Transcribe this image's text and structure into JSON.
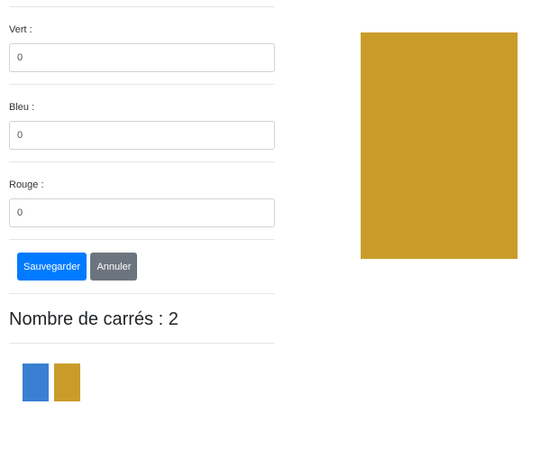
{
  "form": {
    "fields": [
      {
        "label": "Vert :",
        "value": "0"
      },
      {
        "label": "Bleu :",
        "value": "0"
      },
      {
        "label": "Rouge :",
        "value": "0"
      }
    ],
    "save_label": "Sauvegarder",
    "cancel_label": "Annuler"
  },
  "squares": {
    "count_title": "Nombre de carrés : 2",
    "items": [
      {
        "color": "#3a7fd1"
      },
      {
        "color": "#c99c2a"
      }
    ]
  },
  "preview": {
    "color": "#c99c2a"
  },
  "colors": {
    "primary": "#007bff",
    "secondary": "#6c757d"
  }
}
